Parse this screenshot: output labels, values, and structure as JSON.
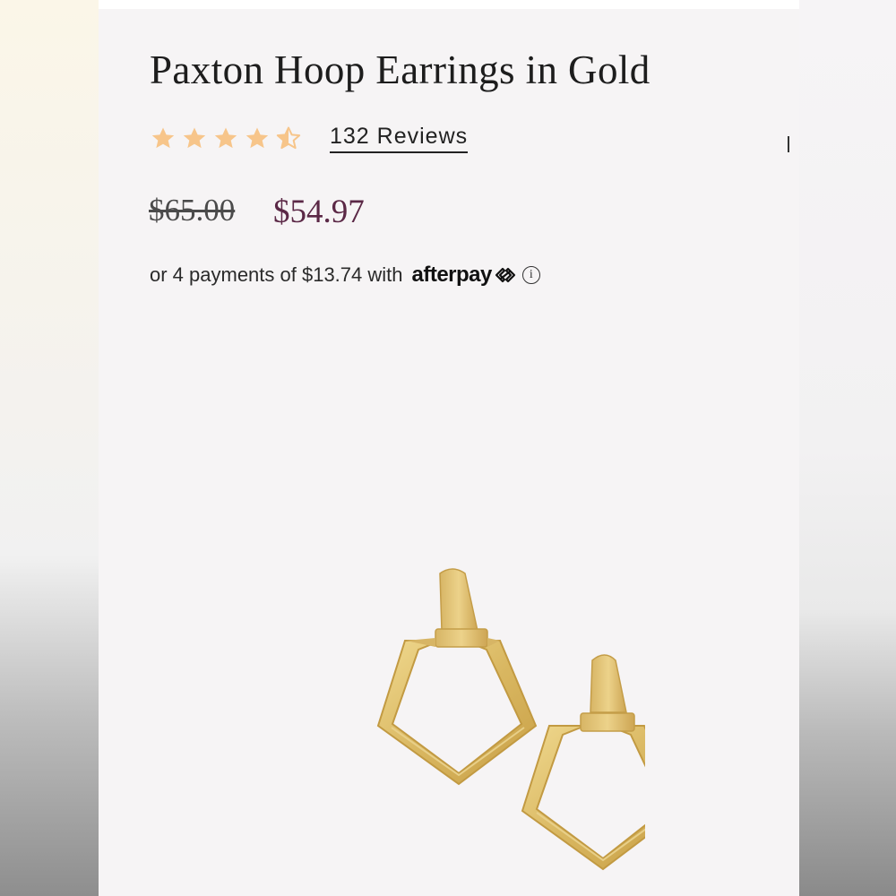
{
  "product": {
    "title": "Paxton Hoop Earrings in Gold",
    "rating": {
      "value": 4.5,
      "max": 5,
      "star_color": "#f7c58a"
    },
    "reviews_label": "132 Reviews"
  },
  "pricing": {
    "original_price": "$65.00",
    "sale_price": "$54.97",
    "sale_price_color": "#5b2846"
  },
  "afterpay": {
    "text": "or 4 payments of $13.74 with",
    "brand": "afterpay",
    "logo_icon": "afterpay-arrows-icon",
    "info_icon": "info-icon"
  },
  "image": {
    "subject": "product-photo-gold-earrings",
    "metal_color": "#e0bf6e"
  }
}
